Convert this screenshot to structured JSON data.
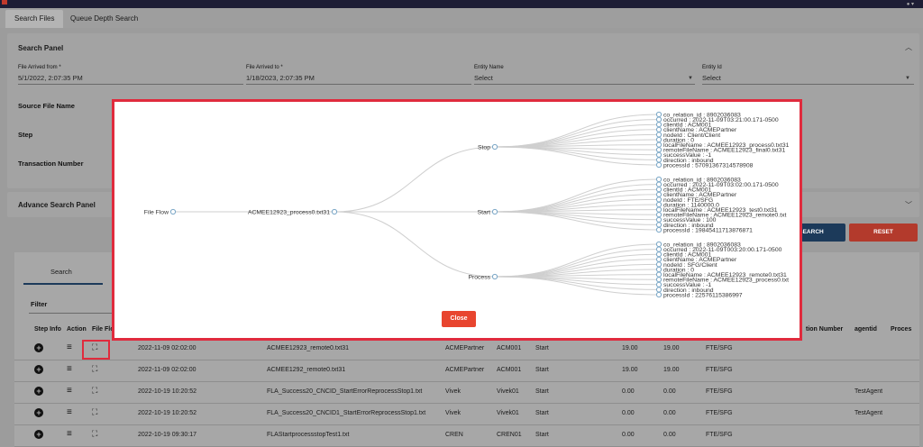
{
  "tabs": [
    {
      "label": "Search Files",
      "active": true
    },
    {
      "label": "Queue Depth Search",
      "active": false
    }
  ],
  "search_panel": {
    "title": "Search Panel",
    "fields": [
      {
        "label": "File Arrived from *",
        "value": "5/1/2022, 2:07:35 PM"
      },
      {
        "label": "File Arrived to *",
        "value": "1/18/2023, 2:07:35 PM"
      },
      {
        "label": "Entity Name",
        "value": "Select"
      },
      {
        "label": "Entity Id",
        "value": "Select"
      }
    ],
    "rows": [
      "Source File Name",
      "Step",
      "Transaction Number"
    ]
  },
  "advance_panel": {
    "title": "Advance Search Panel"
  },
  "buttons": {
    "search": "SEARCH",
    "reset": "RESET"
  },
  "results": {
    "tab_search": "Search",
    "filter_label": "Filter",
    "headers": [
      "Step Info",
      "Action",
      "File Flow",
      "tion Number",
      "agentid",
      "Proces"
    ],
    "rows": [
      {
        "date": "2022-11-09 02:02:00",
        "file": "ACMEE12923_remote0.txt31",
        "entity": "ACMEPartner",
        "id": "ACM001",
        "step": "Start",
        "v1": "19.00",
        "v2": "19.00",
        "proto": "FTE/SFG",
        "agent": ""
      },
      {
        "date": "2022-11-09 02:02:00",
        "file": "ACMEE1292_remote0.txt31",
        "entity": "ACMEPartner",
        "id": "ACM001",
        "step": "Start",
        "v1": "19.00",
        "v2": "19.00",
        "proto": "FTE/SFG",
        "agent": ""
      },
      {
        "date": "2022-10-19 10:20:52",
        "file": "FLA_Success20_CNCID_StartErrorReprocessStop1.txt",
        "entity": "Vivek",
        "id": "Vivek01",
        "step": "Start",
        "v1": "0.00",
        "v2": "0.00",
        "proto": "FTE/SFG",
        "agent": "TestAgent"
      },
      {
        "date": "2022-10-19 10:20:52",
        "file": "FLA_Success20_CNCID1_StartErrorReprocessStop1.txt",
        "entity": "Vivek",
        "id": "Vivek01",
        "step": "Start",
        "v1": "0.00",
        "v2": "0.00",
        "proto": "FTE/SFG",
        "agent": "TestAgent"
      },
      {
        "date": "2022-10-19 09:30:17",
        "file": "FLAStartprocessstopTest1.txt",
        "entity": "CREN",
        "id": "CREN01",
        "step": "Start",
        "v1": "0.00",
        "v2": "0.00",
        "proto": "FTE/SFG",
        "agent": ""
      }
    ]
  },
  "modal": {
    "root": "File Flow",
    "file": "ACMEE12923_process0.txt31",
    "close_label": "Close",
    "branches": [
      {
        "label": "Stop",
        "items": [
          "co_relation_id : 8902036083",
          "occurred : 2022-11-09T03:21:00.171-0500",
          "clientId : ACM001",
          "clientName : ACMEPartner",
          "nodeId : Client/Client",
          "duration : 0",
          "localFileName : ACMEE12923_process0.txt31",
          "remoteFileName : ACMEE12923_final0.txt31",
          "successValue : -1",
          "direction : inbound",
          "processId : 57091367314578908"
        ]
      },
      {
        "label": "Start",
        "items": [
          "co_relation_id : 8902036083",
          "occurred : 2022-11-09T03:02:00.171-0500",
          "clientId : ACM001",
          "clientName : ACMEPartner",
          "nodeId : FTE/SFG",
          "duration : 1140000.0",
          "localFileName : ACMEE12923_test0.txt31",
          "remoteFileName : ACMEE12923_remote0.txt",
          "successValue : 100",
          "direction : inbound",
          "processId : 19845411713876871"
        ]
      },
      {
        "label": "Process",
        "items": [
          "co_relation_id : 8902036083",
          "occurred : 2022-11-09T003:20:00.171-0500",
          "clientId : ACM001",
          "clientName : ACMEPartner",
          "nodeId : SFG/Client",
          "duration : 0",
          "localFileName : ACMEE12923_remote0.txt31",
          "remoteFileName : ACMEE12923_process0.txt",
          "successValue : -1",
          "direction : inbound",
          "processId : 22576115386997"
        ]
      }
    ]
  }
}
